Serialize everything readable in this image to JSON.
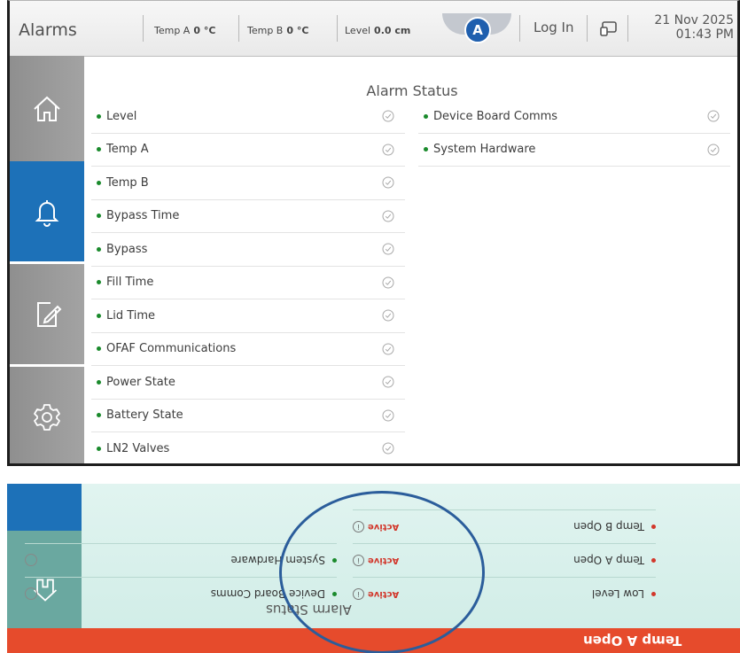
{
  "header": {
    "title": "Alarms",
    "readings": [
      {
        "label": "Temp A",
        "value": "0 °C"
      },
      {
        "label": "Temp B",
        "value": "0 °C"
      },
      {
        "label": "Level",
        "value": "0.0 cm"
      }
    ],
    "badge": "A",
    "login_label": "Log In",
    "date": "21 Nov 2025",
    "time": "01:43 PM"
  },
  "nav": {
    "items": [
      {
        "name": "home",
        "icon": "home-icon",
        "active": false
      },
      {
        "name": "alarms",
        "icon": "bell-icon",
        "active": true
      },
      {
        "name": "notes",
        "icon": "edit-icon",
        "active": false
      },
      {
        "name": "settings",
        "icon": "gear-icon",
        "active": false
      }
    ]
  },
  "alarm_status": {
    "title": "Alarm Status",
    "left": [
      "Level",
      "Temp A",
      "Temp B",
      "Bypass Time",
      "Bypass",
      "Fill Time",
      "Lid Time",
      "OFAF Communications",
      "Power State",
      "Battery State",
      "LN2 Valves"
    ],
    "right": [
      "Device Board Comms",
      "System Hardware"
    ]
  },
  "photo": {
    "banner": "Temp A Open",
    "title": "Alarm Status",
    "left": [
      {
        "label": "Low Level",
        "status": "Active"
      },
      {
        "label": "Temp A Open",
        "status": "Active"
      },
      {
        "label": "Temp B Open",
        "status": "Active"
      }
    ],
    "right": [
      "Device Board Comms",
      "System Hardware"
    ]
  },
  "colors": {
    "accent": "#1d71b8",
    "ok_dot": "#1a8a2c",
    "alarm_dot": "#d2372b",
    "banner": "#e64b2c"
  }
}
